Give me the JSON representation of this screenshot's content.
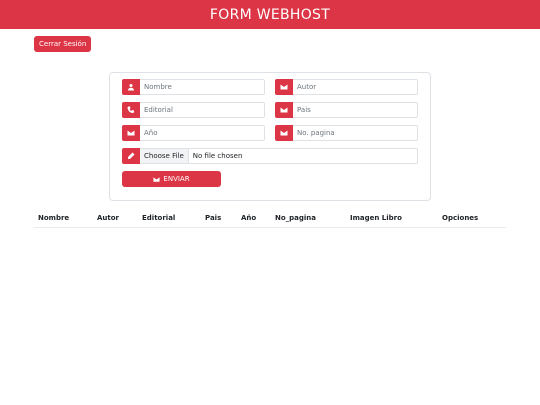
{
  "navbar": {
    "title": "FORM WEBHOST"
  },
  "logout_label": "Cerrar Sesión",
  "form": {
    "nombre": {
      "placeholder": "Nombre",
      "icon": "person-icon"
    },
    "autor": {
      "placeholder": "Autor",
      "icon": "envelope-icon"
    },
    "editorial": {
      "placeholder": "Editorial",
      "icon": "phone-icon"
    },
    "pais": {
      "placeholder": "Pais",
      "icon": "envelope-icon"
    },
    "anio": {
      "placeholder": "Año",
      "icon": "envelope-icon"
    },
    "no_pagina": {
      "placeholder": "No. pagina",
      "icon": "envelope-icon"
    },
    "imagen": {
      "button_label": "Choose File",
      "status": "No file chosen",
      "icon": "pencil-icon"
    },
    "submit_label": "ENVIAR"
  },
  "table": {
    "headers": [
      "Nombre",
      "Autor",
      "Editorial",
      "Pais",
      "Año",
      "No_pagina",
      "Imagen Libro",
      "Opciones"
    ]
  },
  "colors": {
    "accent": "#dc3545"
  }
}
